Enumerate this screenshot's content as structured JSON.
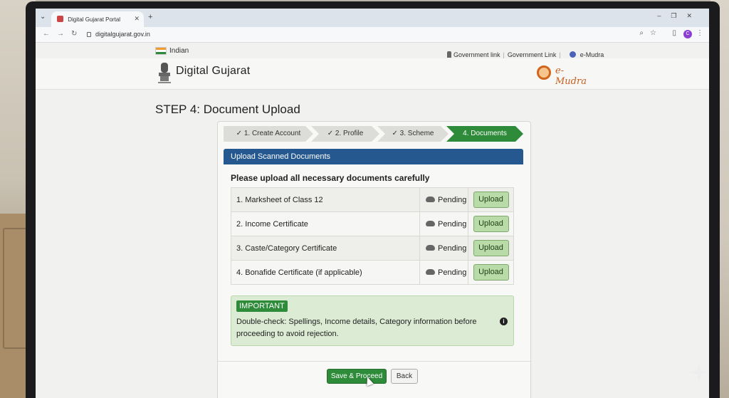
{
  "browser": {
    "tab_title": "Digital Gujarat Portal",
    "new_tab": "+",
    "url": "digitalgujarat.gov.in"
  },
  "site": {
    "language": "Indian",
    "top_links": [
      "Government link",
      "Government Link",
      "e-Mudra"
    ],
    "brand": "Digital Gujarat",
    "partner_logo": "e-Mudra"
  },
  "page": {
    "title": "STEP 4: Document Upload"
  },
  "wizard": {
    "steps": [
      {
        "label": "✓ 1. Create Account",
        "state": "done"
      },
      {
        "label": "✓ 2. Profile",
        "state": "done"
      },
      {
        "label": "✓ 3. Scheme",
        "state": "done"
      },
      {
        "label": "4. Documents",
        "state": "active"
      }
    ]
  },
  "upload": {
    "section_title": "Upload Scanned Documents",
    "instruction": "Please upload all necessary documents carefully",
    "documents": [
      {
        "name": "1. Marksheet of Class 12",
        "status": "Pending",
        "action": "Upload"
      },
      {
        "name": "2. Income Certificate",
        "status": "Pending",
        "action": "Upload"
      },
      {
        "name": "3. Caste/Category Certificate",
        "status": "Pending",
        "action": "Upload"
      },
      {
        "name": "4. Bonafide Certificate (if applicable)",
        "status": "Pending",
        "action": "Upload"
      }
    ],
    "alert": {
      "badge": "IMPORTANT",
      "text": "Double-check: Spellings, Income details, Category information before proceeding to avoid rejection."
    }
  },
  "actions": {
    "save": "Save & Proceed",
    "back": "Back"
  },
  "colors": {
    "primary_green": "#2e8b3a",
    "header_blue": "#24588f",
    "upload_button": "#b9dba8"
  }
}
